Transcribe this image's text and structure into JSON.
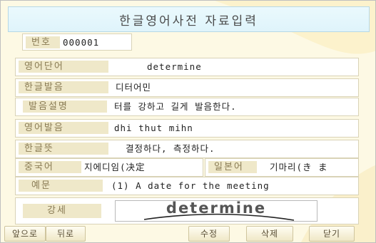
{
  "title": "한글영어사전 자료입력",
  "number": {
    "label": "번호",
    "value": "000001"
  },
  "english_word": {
    "label": "영어단어",
    "value": "determine"
  },
  "korean_pron": {
    "label": "한글발음",
    "value": "디터어민"
  },
  "pron_desc": {
    "label": "발음설명",
    "value": "터를 강하고 길게 발음한다."
  },
  "english_pron": {
    "label": "영어발음",
    "value": "dhi thut mihn"
  },
  "korean_meaning": {
    "label": "한글뜻",
    "value": "결정하다, 측정하다."
  },
  "chinese": {
    "label": "중국어",
    "value": "지에디임(决定"
  },
  "japanese": {
    "label": "일본어",
    "value": "기마리(き ま"
  },
  "example": {
    "label": "예문",
    "value": "(1) A date for the meeting"
  },
  "stress": {
    "label": "강세",
    "image_text": "determine"
  },
  "buttons": {
    "prev": "앞으로",
    "next": "뒤로",
    "edit": "수정",
    "delete": "삭제",
    "close": "닫기"
  },
  "colors": {
    "title_bg": "#dff4fb",
    "label_bg": "#efe8c9",
    "panel_bg": "#fdf9e4"
  }
}
